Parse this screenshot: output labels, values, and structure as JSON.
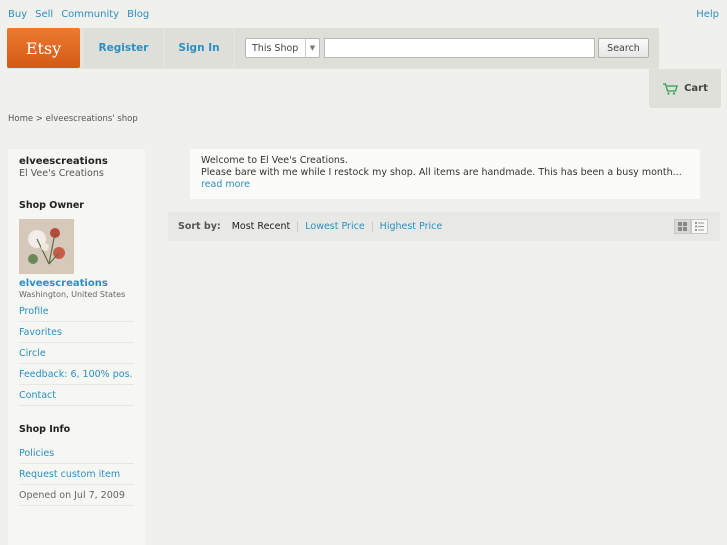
{
  "topnav": {
    "buy": "Buy",
    "sell": "Sell",
    "community": "Community",
    "blog": "Blog",
    "help": "Help"
  },
  "header": {
    "logo": "Etsy",
    "register": "Register",
    "signin": "Sign In",
    "search_scope": "This Shop",
    "search_value": "",
    "search_button": "Search",
    "cart": "Cart"
  },
  "breadcrumb": "Home > elveescreations' shop",
  "sidebar": {
    "shop_name": "elveescreations",
    "shop_title": "El Vee's Creations",
    "owner_heading": "Shop Owner",
    "owner_name": "elveescreations",
    "owner_location": "Washington, United States",
    "links": [
      "Profile",
      "Favorites",
      "Circle",
      "Feedback: 6, 100% pos.",
      "Contact"
    ],
    "info_heading": "Shop Info",
    "info_links": [
      "Policies",
      "Request custom item"
    ],
    "opened": "Opened on Jul 7, 2009"
  },
  "notice": {
    "line1": "Welcome to El Vee's Creations.",
    "line2": "Please bare with me while I restock my shop. All items are handmade. This has been a busy month... ",
    "read_more": "read more"
  },
  "sort": {
    "label": "Sort by:",
    "options": [
      "Most Recent",
      "Lowest Price",
      "Highest Price"
    ]
  },
  "colors": {
    "link": "#2c8fc2",
    "brand_orange": "#e0671f",
    "background": "#f0f0ed"
  },
  "icons": {
    "cart": "cart-icon",
    "dropdown": "chevron-down-icon",
    "grid_view": "grid-view-icon",
    "list_view": "list-view-icon"
  }
}
